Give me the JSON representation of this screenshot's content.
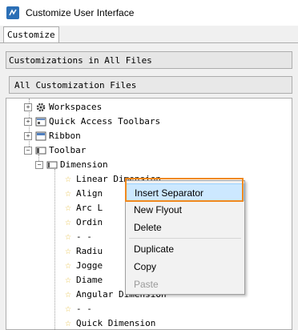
{
  "window": {
    "title": "Customize User Interface"
  },
  "tabs": [
    {
      "label": "Customize"
    }
  ],
  "customizations_header": "Customizations in All Files",
  "files_combo": {
    "value": "All Customization Files"
  },
  "tree": {
    "workspaces": "Workspaces",
    "quick_access_toolbars": "Quick Access Toolbars",
    "ribbon": "Ribbon",
    "toolbar": "Toolbar",
    "dimension": "Dimension",
    "items": [
      "Linear Dimension",
      "Align",
      "Arc L",
      "Ordin",
      "- -",
      "Radiu",
      "Jogge",
      "Diame",
      "Angular Dimension",
      "- -",
      "Quick Dimension"
    ]
  },
  "context_menu": {
    "items": [
      {
        "label": "Insert Separator",
        "highlighted": true,
        "enabled": true
      },
      {
        "label": "New Flyout",
        "enabled": true
      },
      {
        "label": "Delete",
        "enabled": true
      },
      {
        "label": "Duplicate",
        "enabled": true
      },
      {
        "label": "Copy",
        "enabled": true
      },
      {
        "label": "Paste",
        "enabled": false
      }
    ]
  },
  "colors": {
    "callout_border": "#f0891e",
    "highlight": "#cce8ff"
  }
}
